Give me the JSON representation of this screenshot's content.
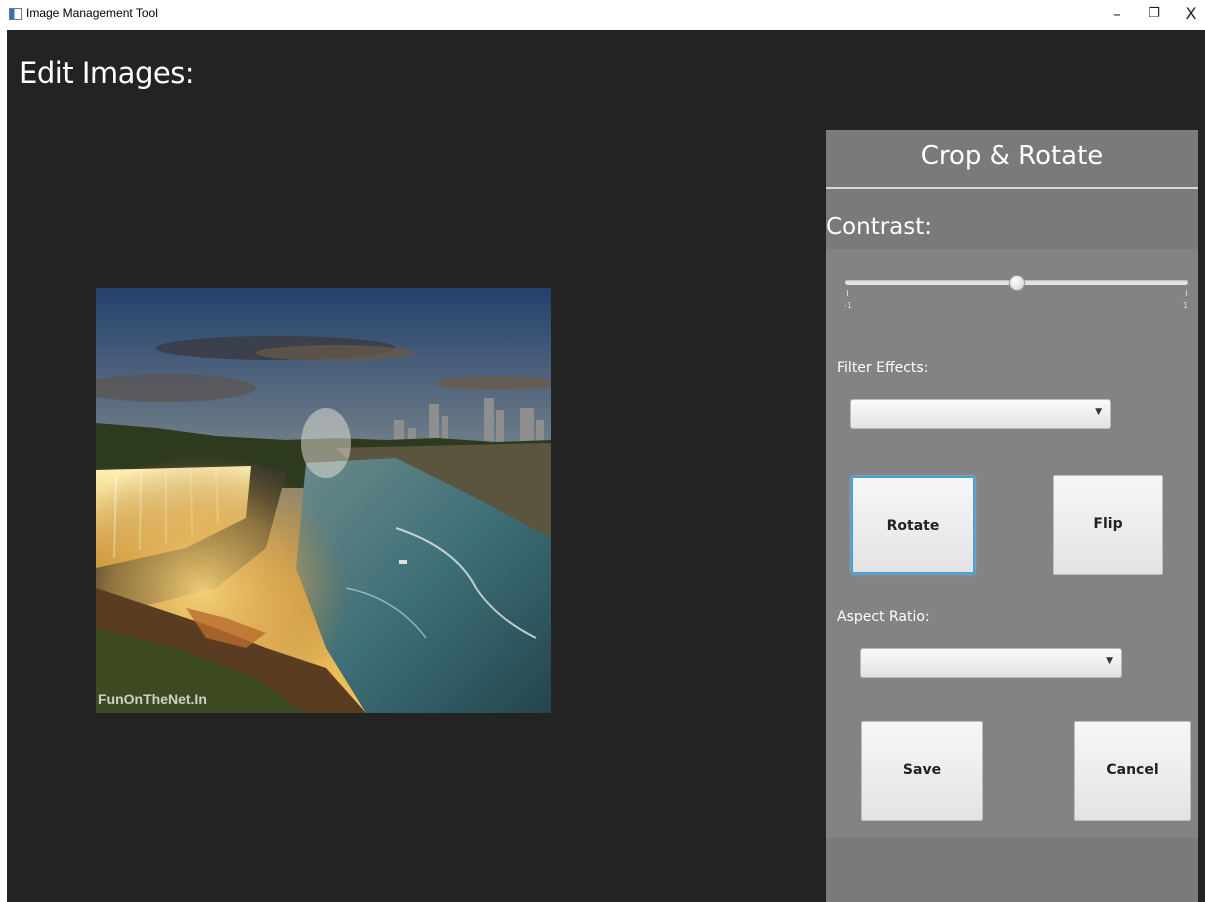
{
  "window": {
    "title": "Image Management Tool",
    "controls": {
      "minimize": "–",
      "maximize": "❐",
      "close": "X"
    }
  },
  "main": {
    "heading": "Edit Images:",
    "image": {
      "watermark": "FunOnTheNet.In"
    }
  },
  "panel": {
    "title": "Crop & Rotate",
    "contrast": {
      "label": "Contrast:",
      "min_label": "-1",
      "max_label": "1",
      "min": -1,
      "max": 1,
      "value": 0
    },
    "filter_effects": {
      "label": "Filter Effects:",
      "selected": ""
    },
    "rotate_button": "Rotate",
    "flip_button": "Flip",
    "aspect_ratio": {
      "label": "Aspect Ratio:",
      "selected": ""
    },
    "save_button": "Save",
    "cancel_button": "Cancel"
  },
  "colors": {
    "window_bg": "#232323",
    "panel_bg": "#7a7a7a",
    "focus_ring": "#3fa4dd"
  }
}
